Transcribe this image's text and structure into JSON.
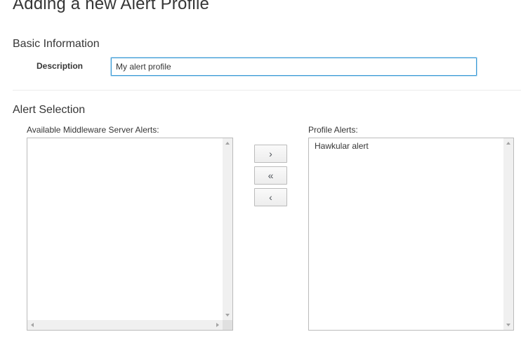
{
  "page": {
    "title": "Adding a new Alert Profile"
  },
  "basic_information": {
    "title": "Basic Information",
    "description_label": "Description",
    "description_value": "My alert profile"
  },
  "alert_selection": {
    "title": "Alert Selection",
    "available_label": "Available Middleware Server Alerts:",
    "available_items": [],
    "profile_label": "Profile Alerts:",
    "profile_items": [
      "Hawkular alert"
    ],
    "buttons": {
      "add": "›",
      "remove_all": "«",
      "remove": "‹"
    },
    "button_icons": {
      "add": "chevron-right-icon",
      "remove_all": "double-chevron-left-icon",
      "remove": "chevron-left-icon"
    }
  },
  "colors": {
    "input_focus_border": "#3b9bd6",
    "text": "#363636",
    "border": "#bbbbbb"
  }
}
